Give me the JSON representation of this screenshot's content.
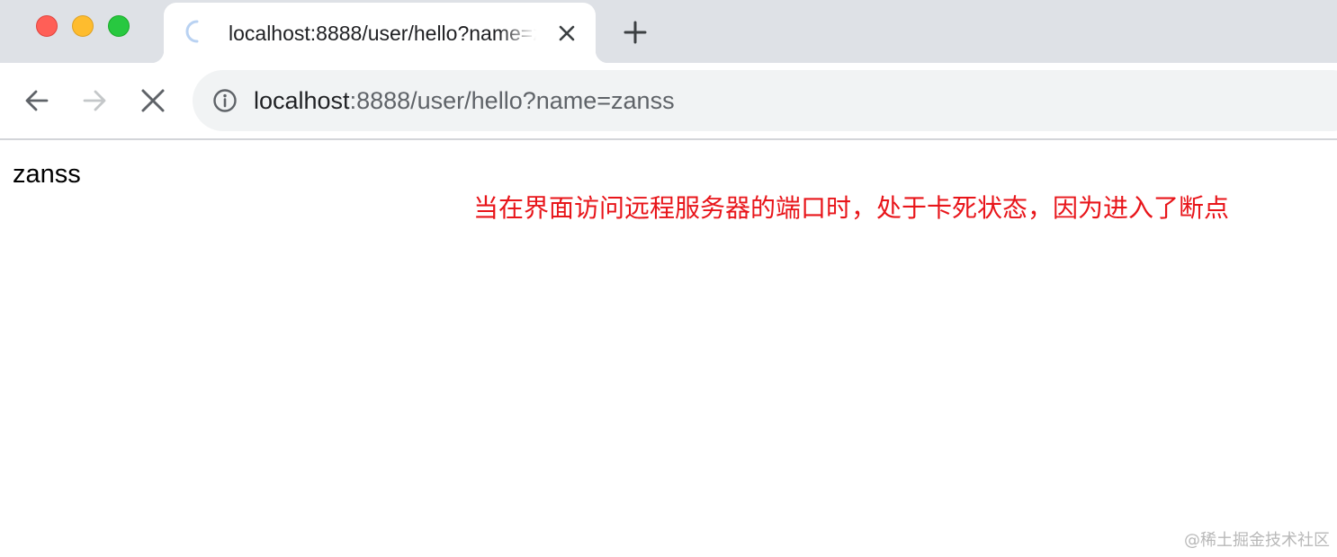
{
  "window": {
    "controls": [
      "close",
      "minimize",
      "maximize"
    ]
  },
  "tab": {
    "title": "localhost:8888/user/hello?name=zanss",
    "loading": true,
    "close_icon": "close-icon",
    "spinner_icon": "loading-spinner-icon"
  },
  "new_tab_icon": "plus-icon",
  "toolbar": {
    "back_icon": "arrow-left-icon",
    "forward_icon": "arrow-right-icon",
    "forward_enabled": false,
    "stop_icon": "close-icon"
  },
  "address_bar": {
    "info_icon": "info-icon",
    "host": "localhost",
    "rest": ":8888/user/hello?name=zanss"
  },
  "page": {
    "body_text": "zanss",
    "annotation": "当在界面访问远程服务器的端口时，处于卡死状态，因为进入了断点",
    "watermark": "@稀土掘金技术社区"
  },
  "colors": {
    "annotation": "#e8151a",
    "spinner": "#b9d2f2",
    "tabstrip": "#dee1e6",
    "omnibox": "#f1f3f4"
  }
}
